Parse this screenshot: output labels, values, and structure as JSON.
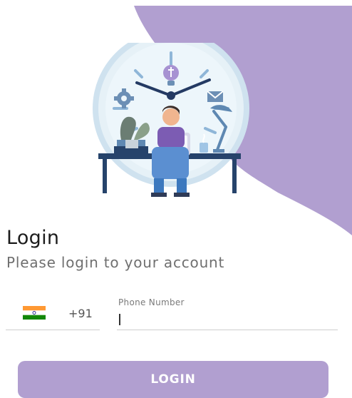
{
  "colors": {
    "accent": "#B19FD0",
    "button_text": "#FFFFFF",
    "title": "#1C1C1C",
    "subtitle": "#6F6F6F"
  },
  "illustration": {
    "icon": "clock-illustration-icon"
  },
  "login": {
    "title": "Login",
    "subtitle": "Please login to your account",
    "country": {
      "flag_icon": "india-flag-icon",
      "code": "+91"
    },
    "phone": {
      "label": "Phone Number",
      "value": ""
    },
    "button_label": "LOGIN"
  }
}
